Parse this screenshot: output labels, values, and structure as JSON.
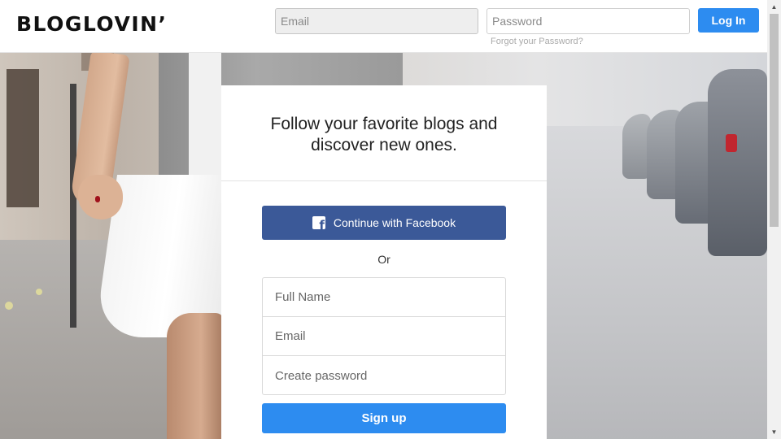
{
  "header": {
    "logo": "BLOGLOVIN’",
    "email_placeholder": "Email",
    "password_placeholder": "Password",
    "login_label": "Log In",
    "forgot_password": "Forgot your Password?"
  },
  "signup": {
    "headline": "Follow your favorite blogs and discover new ones.",
    "facebook_label": "Continue with Facebook",
    "or_label": "Or",
    "full_name_placeholder": "Full Name",
    "email_placeholder": "Email",
    "password_placeholder": "Create password",
    "signup_label": "Sign up"
  },
  "icons": {
    "facebook": "facebook-icon",
    "scroll_up": "arrow-up-icon",
    "scroll_down": "arrow-down-icon"
  },
  "colors": {
    "accent": "#2d8cf0",
    "facebook": "#3b5998",
    "text": "#222222"
  }
}
